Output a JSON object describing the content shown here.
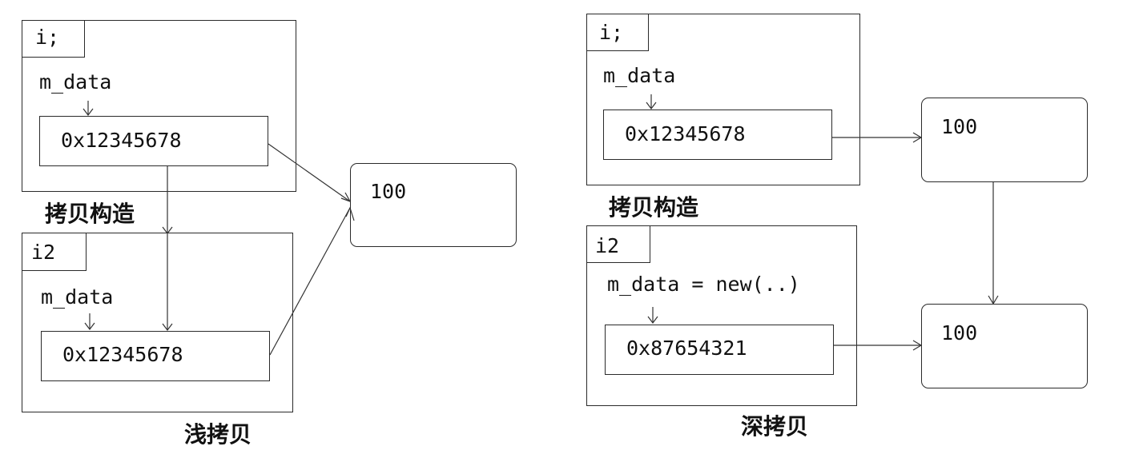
{
  "shallow": {
    "obj1_name": "i;",
    "obj1_member": "m_data",
    "obj1_pointer": "0x12345678",
    "copy_label": "拷贝构造",
    "obj2_name": "i2",
    "obj2_member": "m_data",
    "obj2_pointer": "0x12345678",
    "heap_value": "100",
    "caption": "浅拷贝"
  },
  "deep": {
    "obj1_name": "i;",
    "obj1_member": "m_data",
    "obj1_pointer": "0x12345678",
    "heap1_value": "100",
    "copy_label": "拷贝构造",
    "obj2_name": "i2",
    "obj2_member": "m_data = new(..)",
    "obj2_pointer": "0x87654321",
    "heap2_value": "100",
    "caption": "深拷贝"
  }
}
